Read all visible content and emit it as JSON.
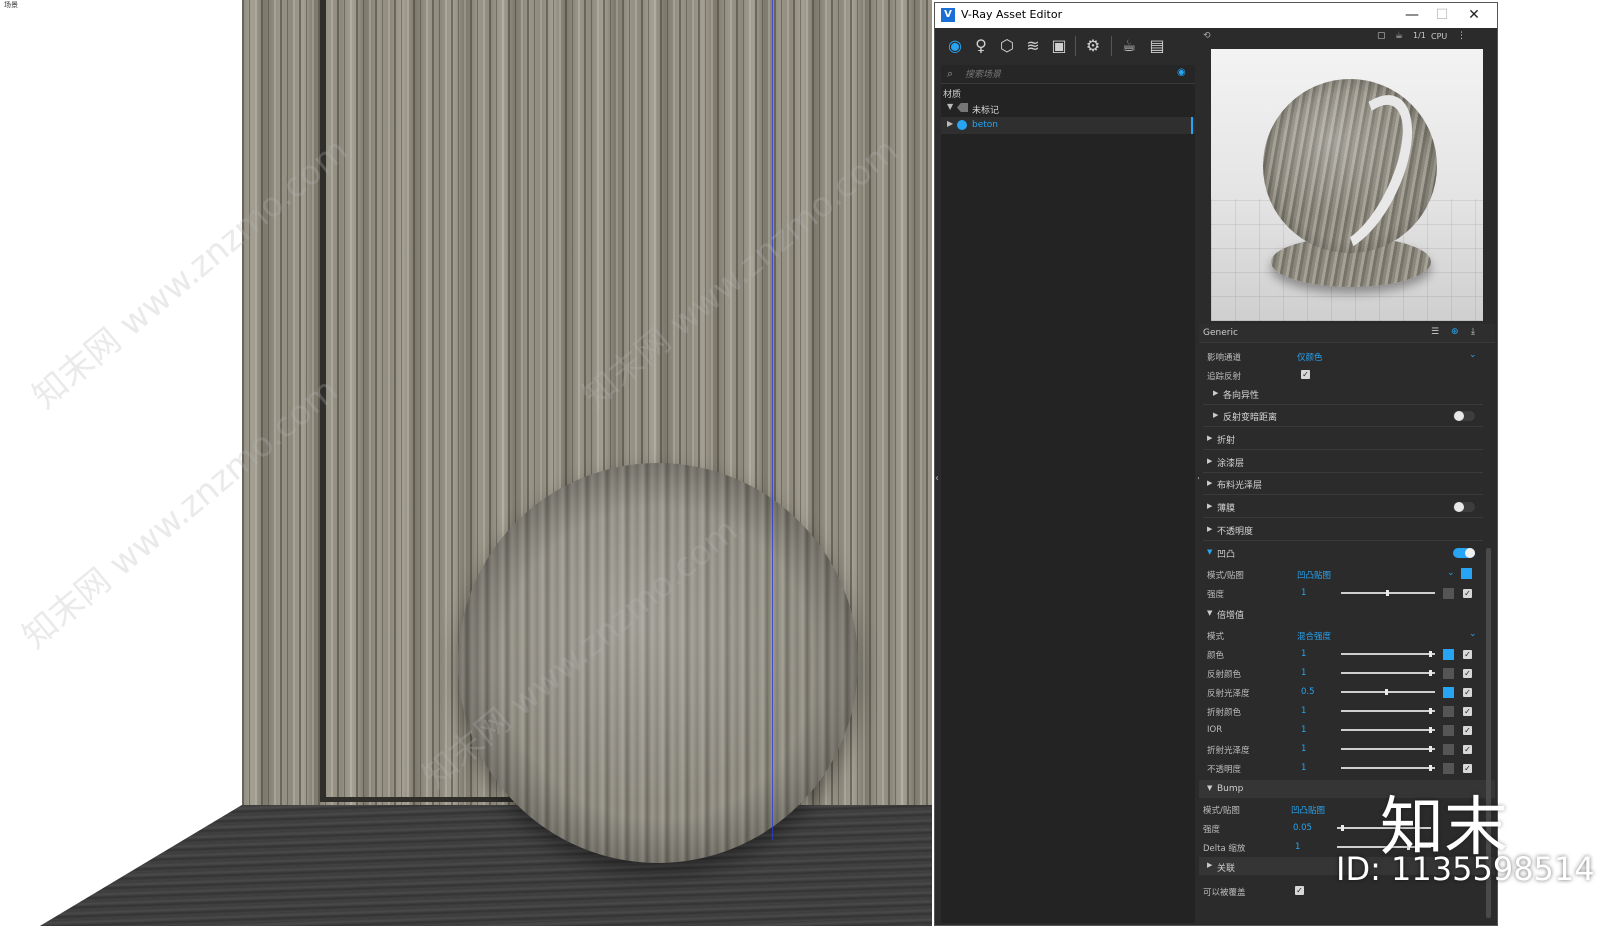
{
  "viewport": {
    "scene_label": "场景"
  },
  "watermark_text": "知末网 www.znzmo.com",
  "editor": {
    "title": "V-Ray Asset Editor",
    "window_buttons": {
      "minimize": "—",
      "maximize": "☐",
      "close": "✕"
    },
    "toolbar_icons": [
      "materials-icon",
      "lights-icon",
      "geometry-icon",
      "layers-icon",
      "render-elements-icon",
      "settings-icon",
      "render-teapot-icon",
      "frame-buffer-icon"
    ],
    "search": {
      "placeholder": "搜索场景"
    },
    "section_title": "材质",
    "tree": [
      {
        "label": "未标记",
        "expanded": true
      },
      {
        "label": "beton",
        "expanded": false,
        "selected": true
      }
    ],
    "preview": {
      "cpu_label": "CPU",
      "ratio_label": "1/1"
    },
    "generic_header": "Generic",
    "props": {
      "affect_channels_label": "影响通道",
      "affect_channels_value": "仅颜色",
      "trace_reflections_label": "追踪反射",
      "anisotropy_label": "各向异性",
      "reflection_dim_label": "反射变暗距离",
      "refraction_label": "折射",
      "coat_label": "涂漆层",
      "sheen_label": "布料光泽层",
      "thin_film_label": "薄膜",
      "opacity_label": "不透明度",
      "bump_section_label": "凹凸",
      "bump_mode_label": "模式/贴图",
      "bump_mode_value": "凹凸贴图",
      "bump_amount_label": "强度",
      "bump_amount_value": "1",
      "multipliers_label": "倍增值",
      "mult_mode_label": "模式",
      "mult_mode_value": "混合强度",
      "multipliers": [
        {
          "label": "颜色",
          "value": "1",
          "level": 1.0,
          "map_on": true
        },
        {
          "label": "反射颜色",
          "value": "1",
          "level": 1.0,
          "map_on": false
        },
        {
          "label": "反射光泽度",
          "value": "0.5",
          "level": 0.5,
          "map_on": true
        },
        {
          "label": "折射颜色",
          "value": "1",
          "level": 1.0,
          "map_on": false
        },
        {
          "label": "IOR",
          "value": "1",
          "level": 1.0,
          "map_on": false
        },
        {
          "label": "折射光泽度",
          "value": "1",
          "level": 1.0,
          "map_on": false
        },
        {
          "label": "不透明度",
          "value": "1",
          "level": 1.0,
          "map_on": false
        }
      ],
      "bump2_label": "Bump",
      "bump2_mode_label": "模式/贴图",
      "bump2_mode_value": "凹凸贴图",
      "bump2_amount_label": "强度",
      "bump2_amount_value": "0.05",
      "delta_scale_label": "Delta 缩放",
      "delta_scale_value": "1",
      "links_label": "关联",
      "can_override_label": "可以被覆盖"
    }
  },
  "brand": {
    "logo": "知末",
    "id": "ID: 1135598514"
  },
  "colors": {
    "accent": "#27a4f2",
    "panel": "#2b2b2b",
    "panel_dark": "#232323"
  }
}
